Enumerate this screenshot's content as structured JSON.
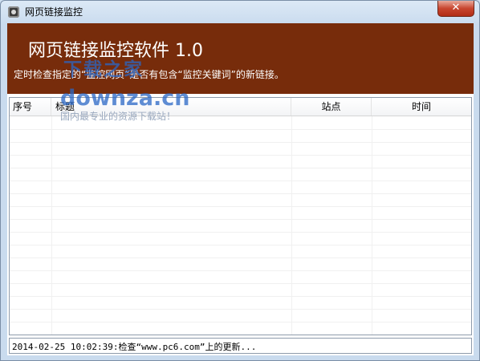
{
  "window": {
    "title": "网页链接监控",
    "close_label": "✕"
  },
  "banner": {
    "title": "网页链接监控软件 1.0",
    "description": "定时检查指定的“监控网页”是否有包含“监控关键词”的新链接。"
  },
  "watermark": {
    "brand": "下载之家",
    "domain": "downza.cn",
    "slogan": "国内最专业的资源下载站！"
  },
  "table": {
    "columns": [
      "序号",
      "标题",
      "站点",
      "时间"
    ],
    "rows": []
  },
  "status": {
    "text": "2014-02-25 10:02:39:检查“www.pc6.com”上的更新..."
  },
  "colors": {
    "banner_bg": "#772c0b",
    "close_button": "#c8452f",
    "watermark": "#2a67c6"
  },
  "icons": {
    "app": "webcam-icon",
    "close": "close-icon"
  }
}
